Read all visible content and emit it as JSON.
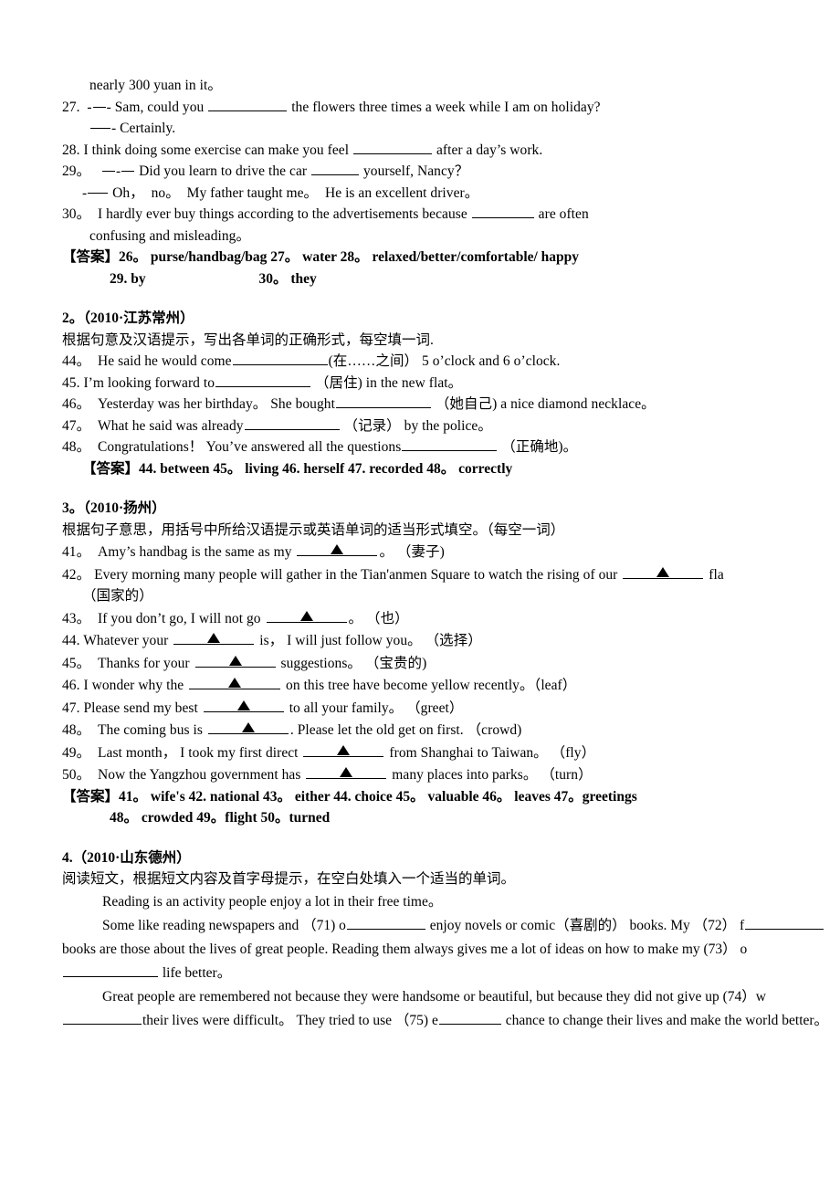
{
  "document": {
    "type": "english-exam-worksheet",
    "language": "zh-CN/en",
    "answer_label": "【答案】"
  },
  "block1": {
    "continuation": "nearly 300 yuan in it。",
    "q27_num": "27.",
    "q27_a": "- Sam, could you",
    "q27_b": "the flowers three times a week while I am on holiday?",
    "q27_reply": "- Certainly.",
    "q28_num": "28.",
    "q28_a": "I think doing some exercise can make you feel",
    "q28_b": "after a day’s work.",
    "q29_num": "29。",
    "q29_a": "Did you learn to drive the car",
    "q29_b": "yourself, Nancy？",
    "q29_reply_a": "Oh，",
    "q29_reply_b": "no。",
    "q29_reply_c": "My father taught me。",
    "q29_reply_d": "He is an excellent driver。",
    "q30_num": "30。",
    "q30_a": "I hardly ever buy things according to the advertisements because",
    "q30_b": "are often",
    "q30_c": "confusing and misleading。",
    "answers_line1": "26。 purse/handbag/bag  27。  water  28。  relaxed/better/comfortable/ happy",
    "answers_line2_a": "29. by",
    "answers_line2_b": "30。  they"
  },
  "section2": {
    "heading": "2。（2010·江苏常州）",
    "directions": "根据句意及汉语提示，写出各单词的正确形式，每空填一词.",
    "q44_num": "44。",
    "q44_a": "He said he would come",
    "q44_b": "(在……之间）  5 o’clock and 6 o’clock.",
    "q45_num": "45.",
    "q45_a": "I’m looking forward to",
    "q45_b": "（居住) in the new flat。",
    "q46_num": "46。",
    "q46_a": "Yesterday was her birthday。   She bought",
    "q46_b": "（她自己) a nice diamond necklace。",
    "q47_num": "47。",
    "q47_a": "What he said was already",
    "q47_b": "（记录）  by the police。",
    "q48_num": "48。",
    "q48_a": "Congratulations！   You’ve answered all the questions",
    "q48_b": "（正确地)。",
    "answers": "44. between    45。  living      46. herself  47. recorded    48。  correctly"
  },
  "section3": {
    "heading": "3。（2010·扬州）",
    "directions": "根据句子意思，用括号中所给汉语提示或英语单词的适当形式填空。（每空一词）",
    "q41_num": "41。",
    "q41_a": "Amy’s handbag is the same as my",
    "q41_b": "。   （妻子)",
    "q42_num": "42。",
    "q42_a": "Every morning many people will gather in the Tian'anmen Square to watch the rising of our",
    "q42_b": "fla",
    "q42_c": "（国家的）",
    "q43_num": "43。",
    "q43_a": "If you don’t go, I will not go",
    "q43_b": "。   （也）",
    "q44_num": "44.",
    "q44_a": "Whatever your",
    "q44_b": "is，  I will just follow you。  （选择）",
    "q45_num": "45。",
    "q45_a": "Thanks for your",
    "q45_b": "suggestions。  （宝贵的)",
    "q46_num": "46.",
    "q46_a": "I wonder why the",
    "q46_b": "on this tree have become yellow recently。（leaf）",
    "q47_num": "47.",
    "q47_a": "Please send my best",
    "q47_b": "to all your family。   （greet）",
    "q48_num": "48。",
    "q48_a": "The coming bus is",
    "q48_b": ". Please let the old get on first.  （crowd)",
    "q49_num": "49。",
    "q49_a": "Last month，  I took my first direct",
    "q49_b": "from Shanghai to Taiwan。   （fly）",
    "q50_num": "50。",
    "q50_a": "Now the Yangzhou government has",
    "q50_b": "many places into parks。   （turn）",
    "answers_line1": "41。  wife's 42. national 43。  either 44. choice 45。  valuable 46。 leaves 47。greetings",
    "answers_line2": "48。  crowded 49。flight 50。turned"
  },
  "section4": {
    "heading": "4.（2010·山东德州）",
    "directions": "阅读短文，根据短文内容及首字母提示，在空白处填入一个适当的单词。",
    "p1": "Reading is an activity people enjoy a lot in their free time。",
    "p2_a": "Some like reading newspapers and  （71) o",
    "p2_b": "enjoy novels or comic（喜剧的）  books. My",
    "p2_c": "（72）  f",
    "p2_d": "books are those about the lives of great people. Reading them always gives me a lot of",
    "p2_e": "ideas on how to make my (73）  o",
    "p2_f": "life better。",
    "p3_a": "Great people are remembered not because they were handsome or beautiful, but because they did not",
    "p3_b": "give up (74）w",
    "p3_c": "their lives were difficult。   They tried to use  （75) e",
    "p3_d": "chance to change",
    "p3_e": "their lives and make the world better。"
  }
}
